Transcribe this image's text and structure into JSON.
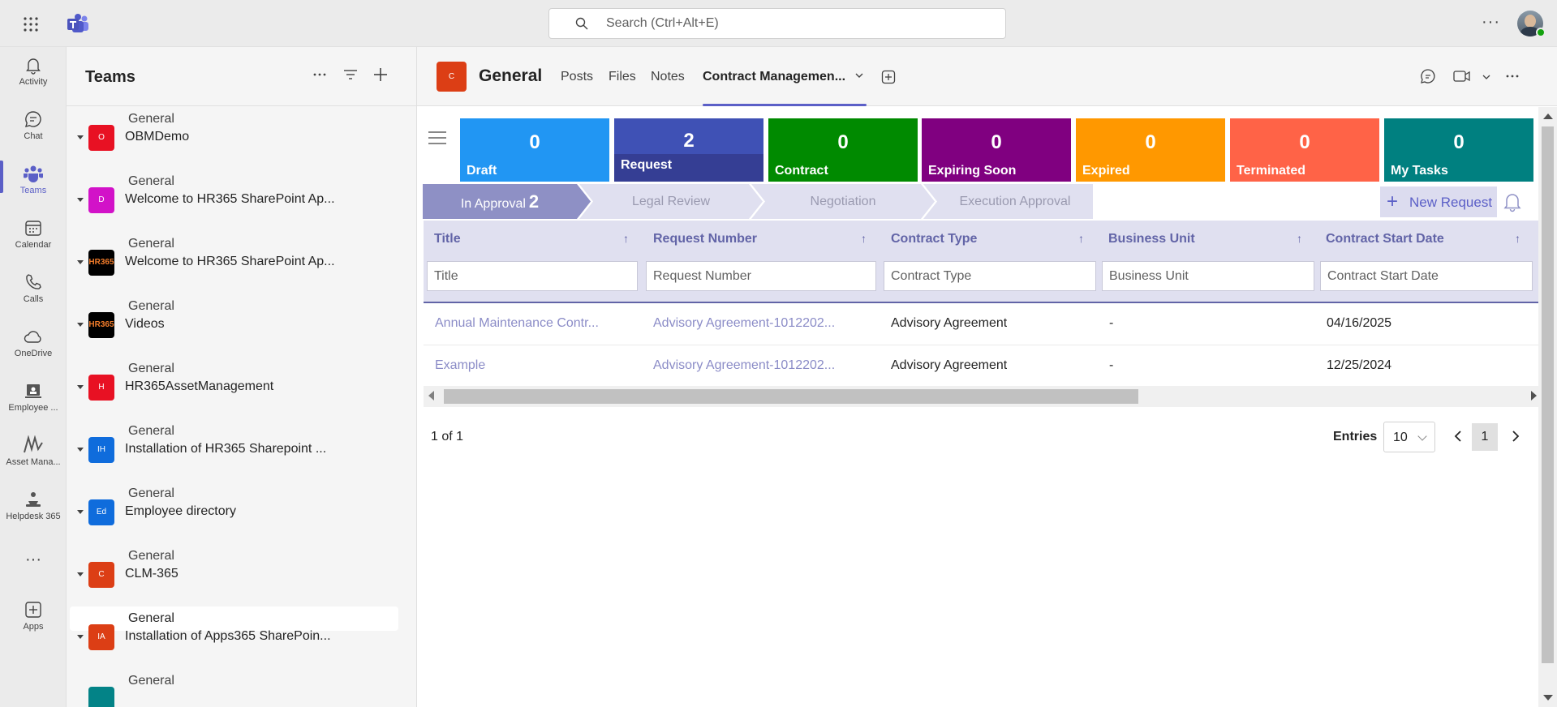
{
  "topbar": {
    "search_placeholder": "Search (Ctrl+Alt+E)",
    "waffle_icon": "app-launcher-icon",
    "logo_icon": "teams-logo-icon",
    "more_label": "···"
  },
  "rail": {
    "items": [
      {
        "label": "Activity",
        "icon": "bell-icon"
      },
      {
        "label": "Chat",
        "icon": "chat-icon"
      },
      {
        "label": "Teams",
        "icon": "teams-icon"
      },
      {
        "label": "Calendar",
        "icon": "calendar-icon"
      },
      {
        "label": "Calls",
        "icon": "phone-icon"
      },
      {
        "label": "OneDrive",
        "icon": "cloud-icon"
      },
      {
        "label": "Employee ...",
        "icon": "employee-directory-icon"
      },
      {
        "label": "Asset Mana...",
        "icon": "asset-management-icon"
      },
      {
        "label": "Helpdesk 365",
        "icon": "helpdesk-icon"
      },
      {
        "label": "···",
        "icon": "more-apps-icon"
      },
      {
        "label": "Apps",
        "icon": "apps-add-icon"
      }
    ]
  },
  "teams_panel": {
    "title": "Teams",
    "first_channel": "General",
    "teams": [
      {
        "name": "OBMDemo",
        "initials": "O",
        "color": "#e81123",
        "channel": "General"
      },
      {
        "name": "Welcome to HR365 SharePoint Ap...",
        "initials": "D",
        "color": "#d212c8",
        "channel": "General"
      },
      {
        "name": "Welcome to HR365 SharePoint Ap...",
        "initials": "HR365",
        "color": "#000000",
        "channel": "General"
      },
      {
        "name": "Videos",
        "initials": "HR365",
        "color": "#000000",
        "channel": "General"
      },
      {
        "name": "HR365AssetManagement",
        "initials": "H",
        "color": "#e81123",
        "channel": "General"
      },
      {
        "name": "Installation of HR365 Sharepoint ...",
        "initials": "IH",
        "color": "#0f6cdc",
        "channel": "General"
      },
      {
        "name": "Employee directory",
        "initials": "Ed",
        "color": "#0f6cdc",
        "channel": "General"
      },
      {
        "name": "CLM-365",
        "initials": "C",
        "color": "#dc3e15",
        "channel": "General"
      },
      {
        "name": "Installation of Apps365 SharePoin...",
        "initials": "IA",
        "color": "#dc3e15",
        "channel": "General"
      }
    ]
  },
  "channel": {
    "initial": "C",
    "name": "General",
    "tabs": [
      "Posts",
      "Files",
      "Notes",
      "Contract Managemen..."
    ]
  },
  "app": {
    "stats": [
      {
        "value": "0",
        "label": "Draft",
        "color": "#2196f3"
      },
      {
        "value": "2",
        "label": "Request",
        "color": "#3f51b5"
      },
      {
        "value": "0",
        "label": "Contract",
        "color": "#008a00"
      },
      {
        "value": "0",
        "label": "Expiring Soon",
        "color": "#800080"
      },
      {
        "value": "0",
        "label": "Expired",
        "color": "#ff9800"
      },
      {
        "value": "0",
        "label": "Terminated",
        "color": "#ff6347"
      },
      {
        "value": "0",
        "label": "My Tasks",
        "color": "#008080"
      }
    ],
    "steps": [
      {
        "label": "In Approval",
        "count": "2"
      },
      {
        "label": "Legal Review",
        "count": ""
      },
      {
        "label": "Negotiation",
        "count": ""
      },
      {
        "label": "Execution Approval",
        "count": ""
      }
    ],
    "new_request": "New Request",
    "columns": [
      {
        "header": "Title",
        "filter": "Title"
      },
      {
        "header": "Request Number",
        "filter": "Request Number"
      },
      {
        "header": "Contract Type",
        "filter": "Contract Type"
      },
      {
        "header": "Business Unit",
        "filter": "Business Unit"
      },
      {
        "header": "Contract Start Date",
        "filter": "Contract Start Date"
      }
    ],
    "rows": [
      [
        "Annual Maintenance Contr...",
        "Advisory Agreement-1012202...",
        "Advisory Agreement",
        "-",
        "04/16/2025"
      ],
      [
        "Example",
        "Advisory Agreement-1012202...",
        "Advisory Agreement",
        "-",
        "12/25/2024"
      ]
    ],
    "page_info": "1 of 1",
    "entries_label": "Entries",
    "entries_value": "10",
    "current_page": "1"
  }
}
